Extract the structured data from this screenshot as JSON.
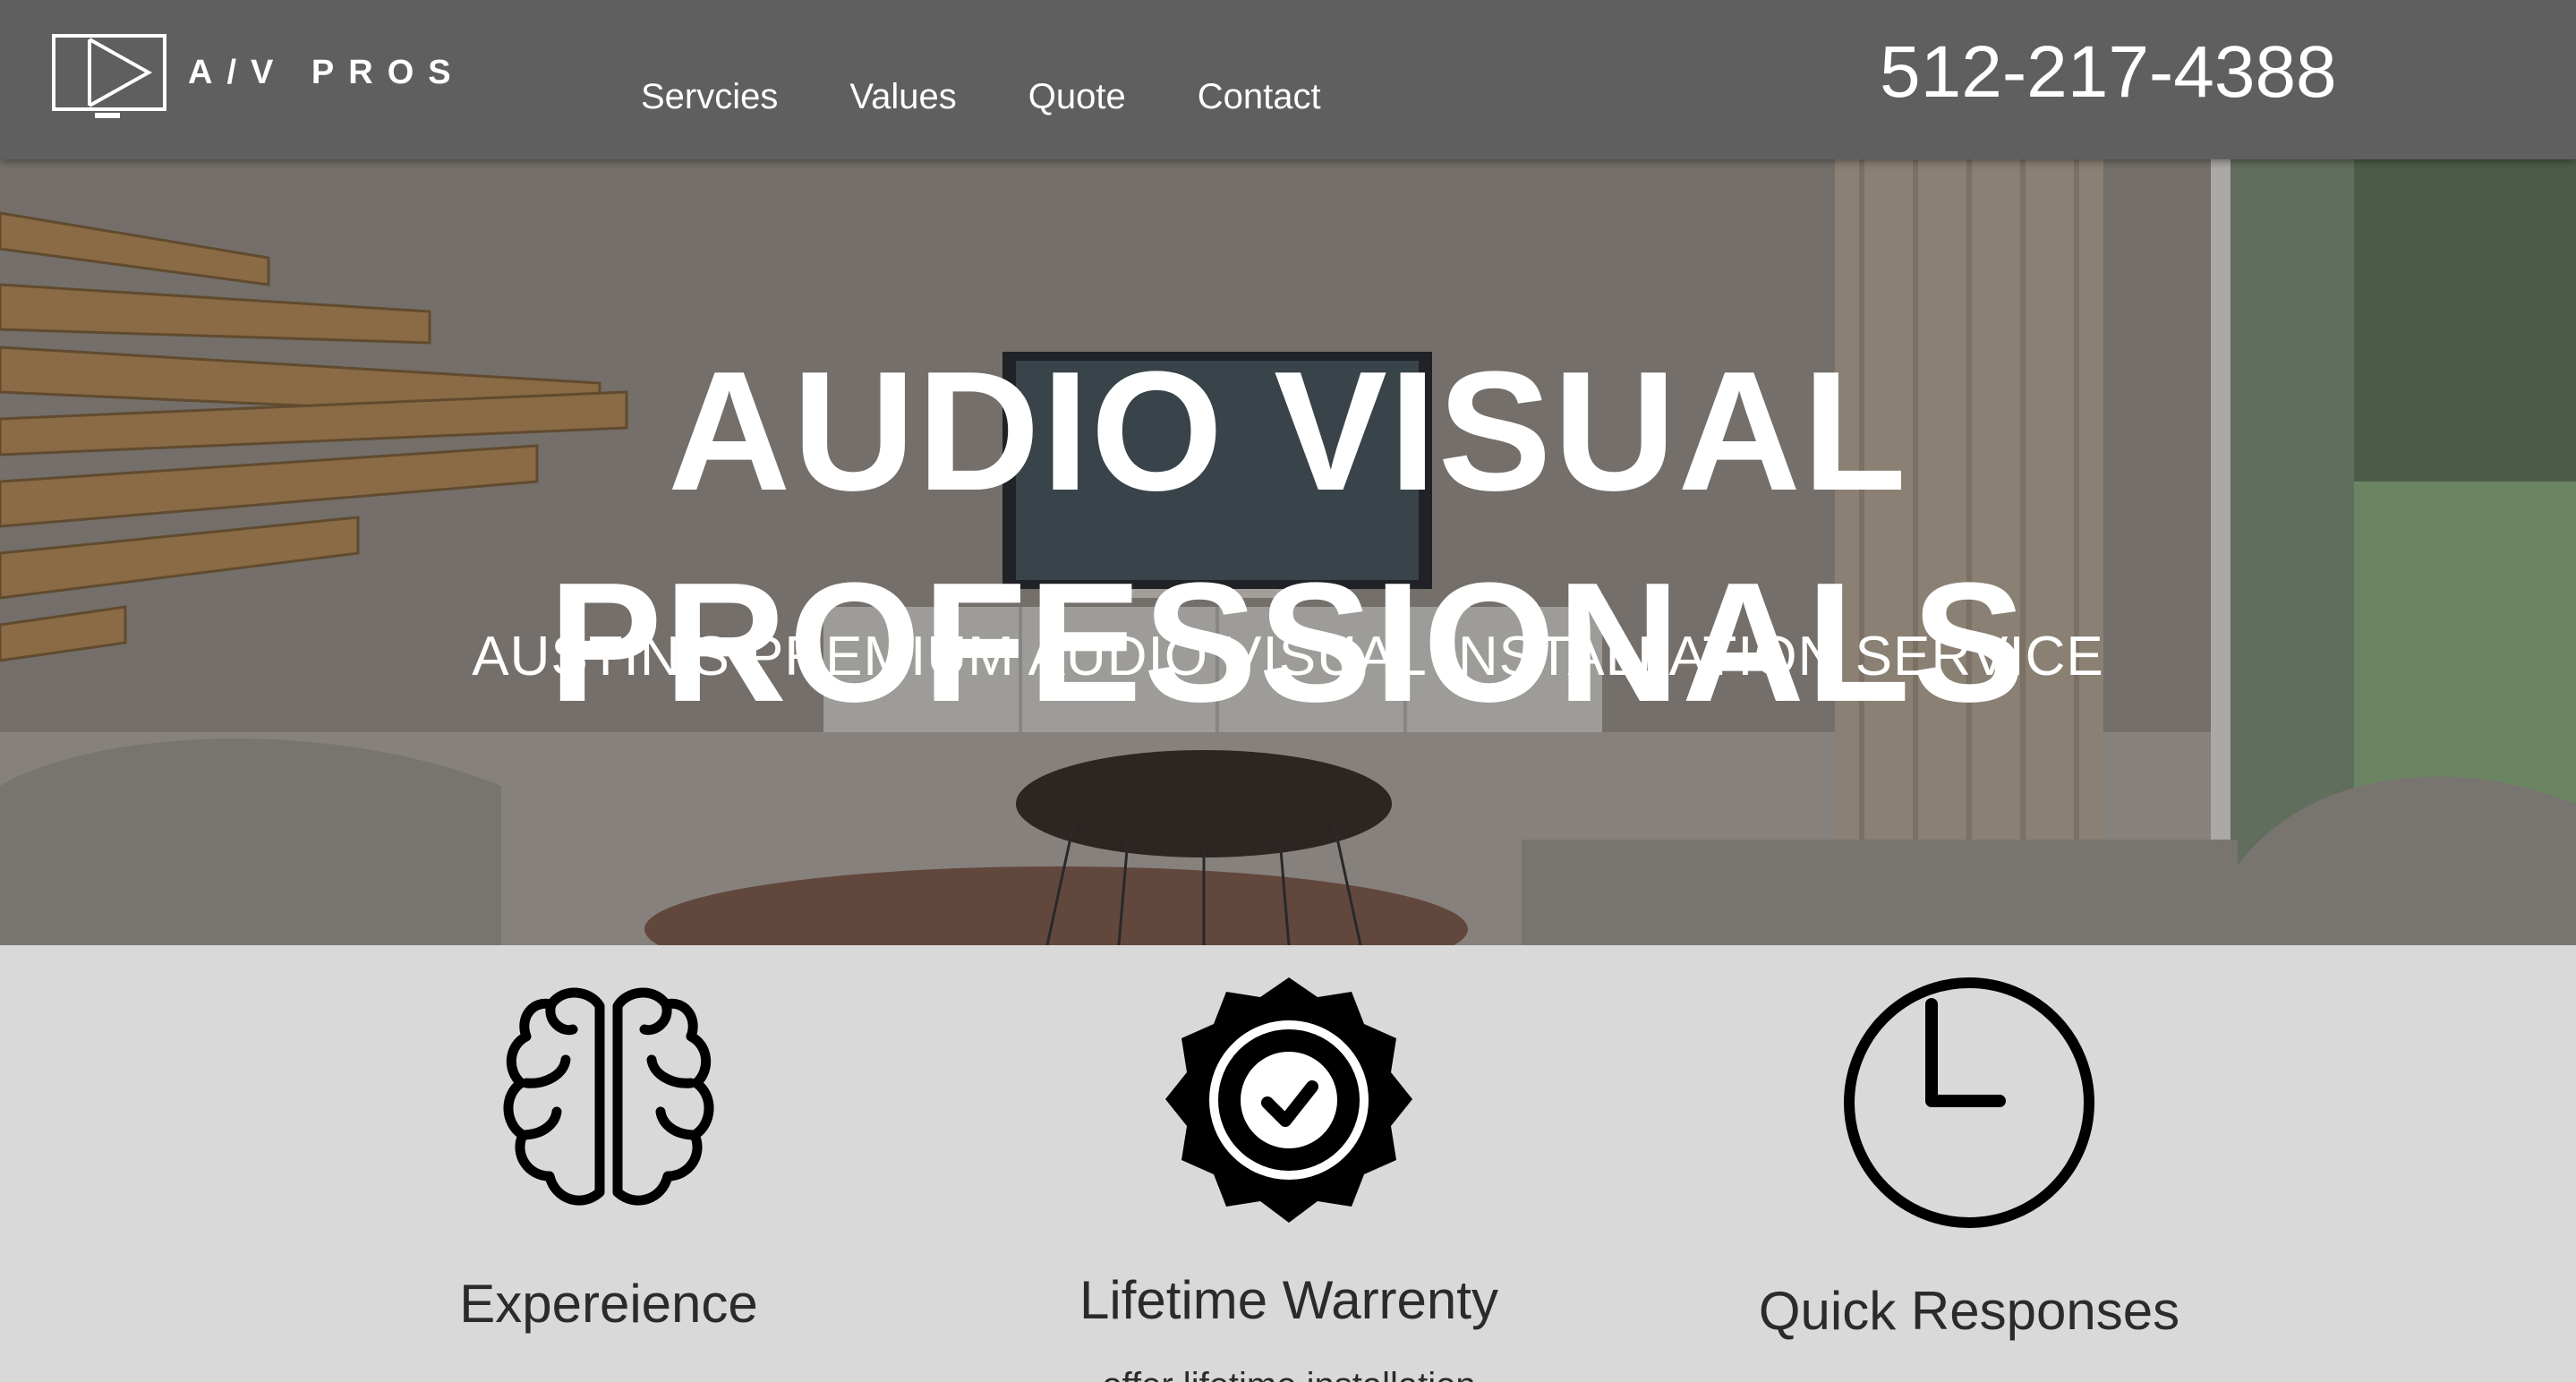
{
  "header": {
    "logo_text": "A/V PROS",
    "nav": [
      "Servcies",
      "Values",
      "Quote",
      "Contact"
    ],
    "phone": "512-217-4388"
  },
  "hero": {
    "title_line1": "AUDIO VISUAL",
    "title_line2": "PROFESSIONALS",
    "subtitle": "AUSTIN'S PREMIUM AUDIO VISUAL INSTALLATION SERVICE"
  },
  "features": [
    {
      "label": "Expereience",
      "icon": "brain-icon"
    },
    {
      "label": "Lifetime Warrenty",
      "icon": "badge-check-icon",
      "desc_partial": "...offer lifetime installation..."
    },
    {
      "label": "Quick Responses",
      "icon": "clock-icon"
    }
  ],
  "colors": {
    "header_bg": "#5f5f5f",
    "features_bg": "#d9d9d9",
    "text_light": "#ffffff",
    "text_dark": "#2b2b2b"
  }
}
